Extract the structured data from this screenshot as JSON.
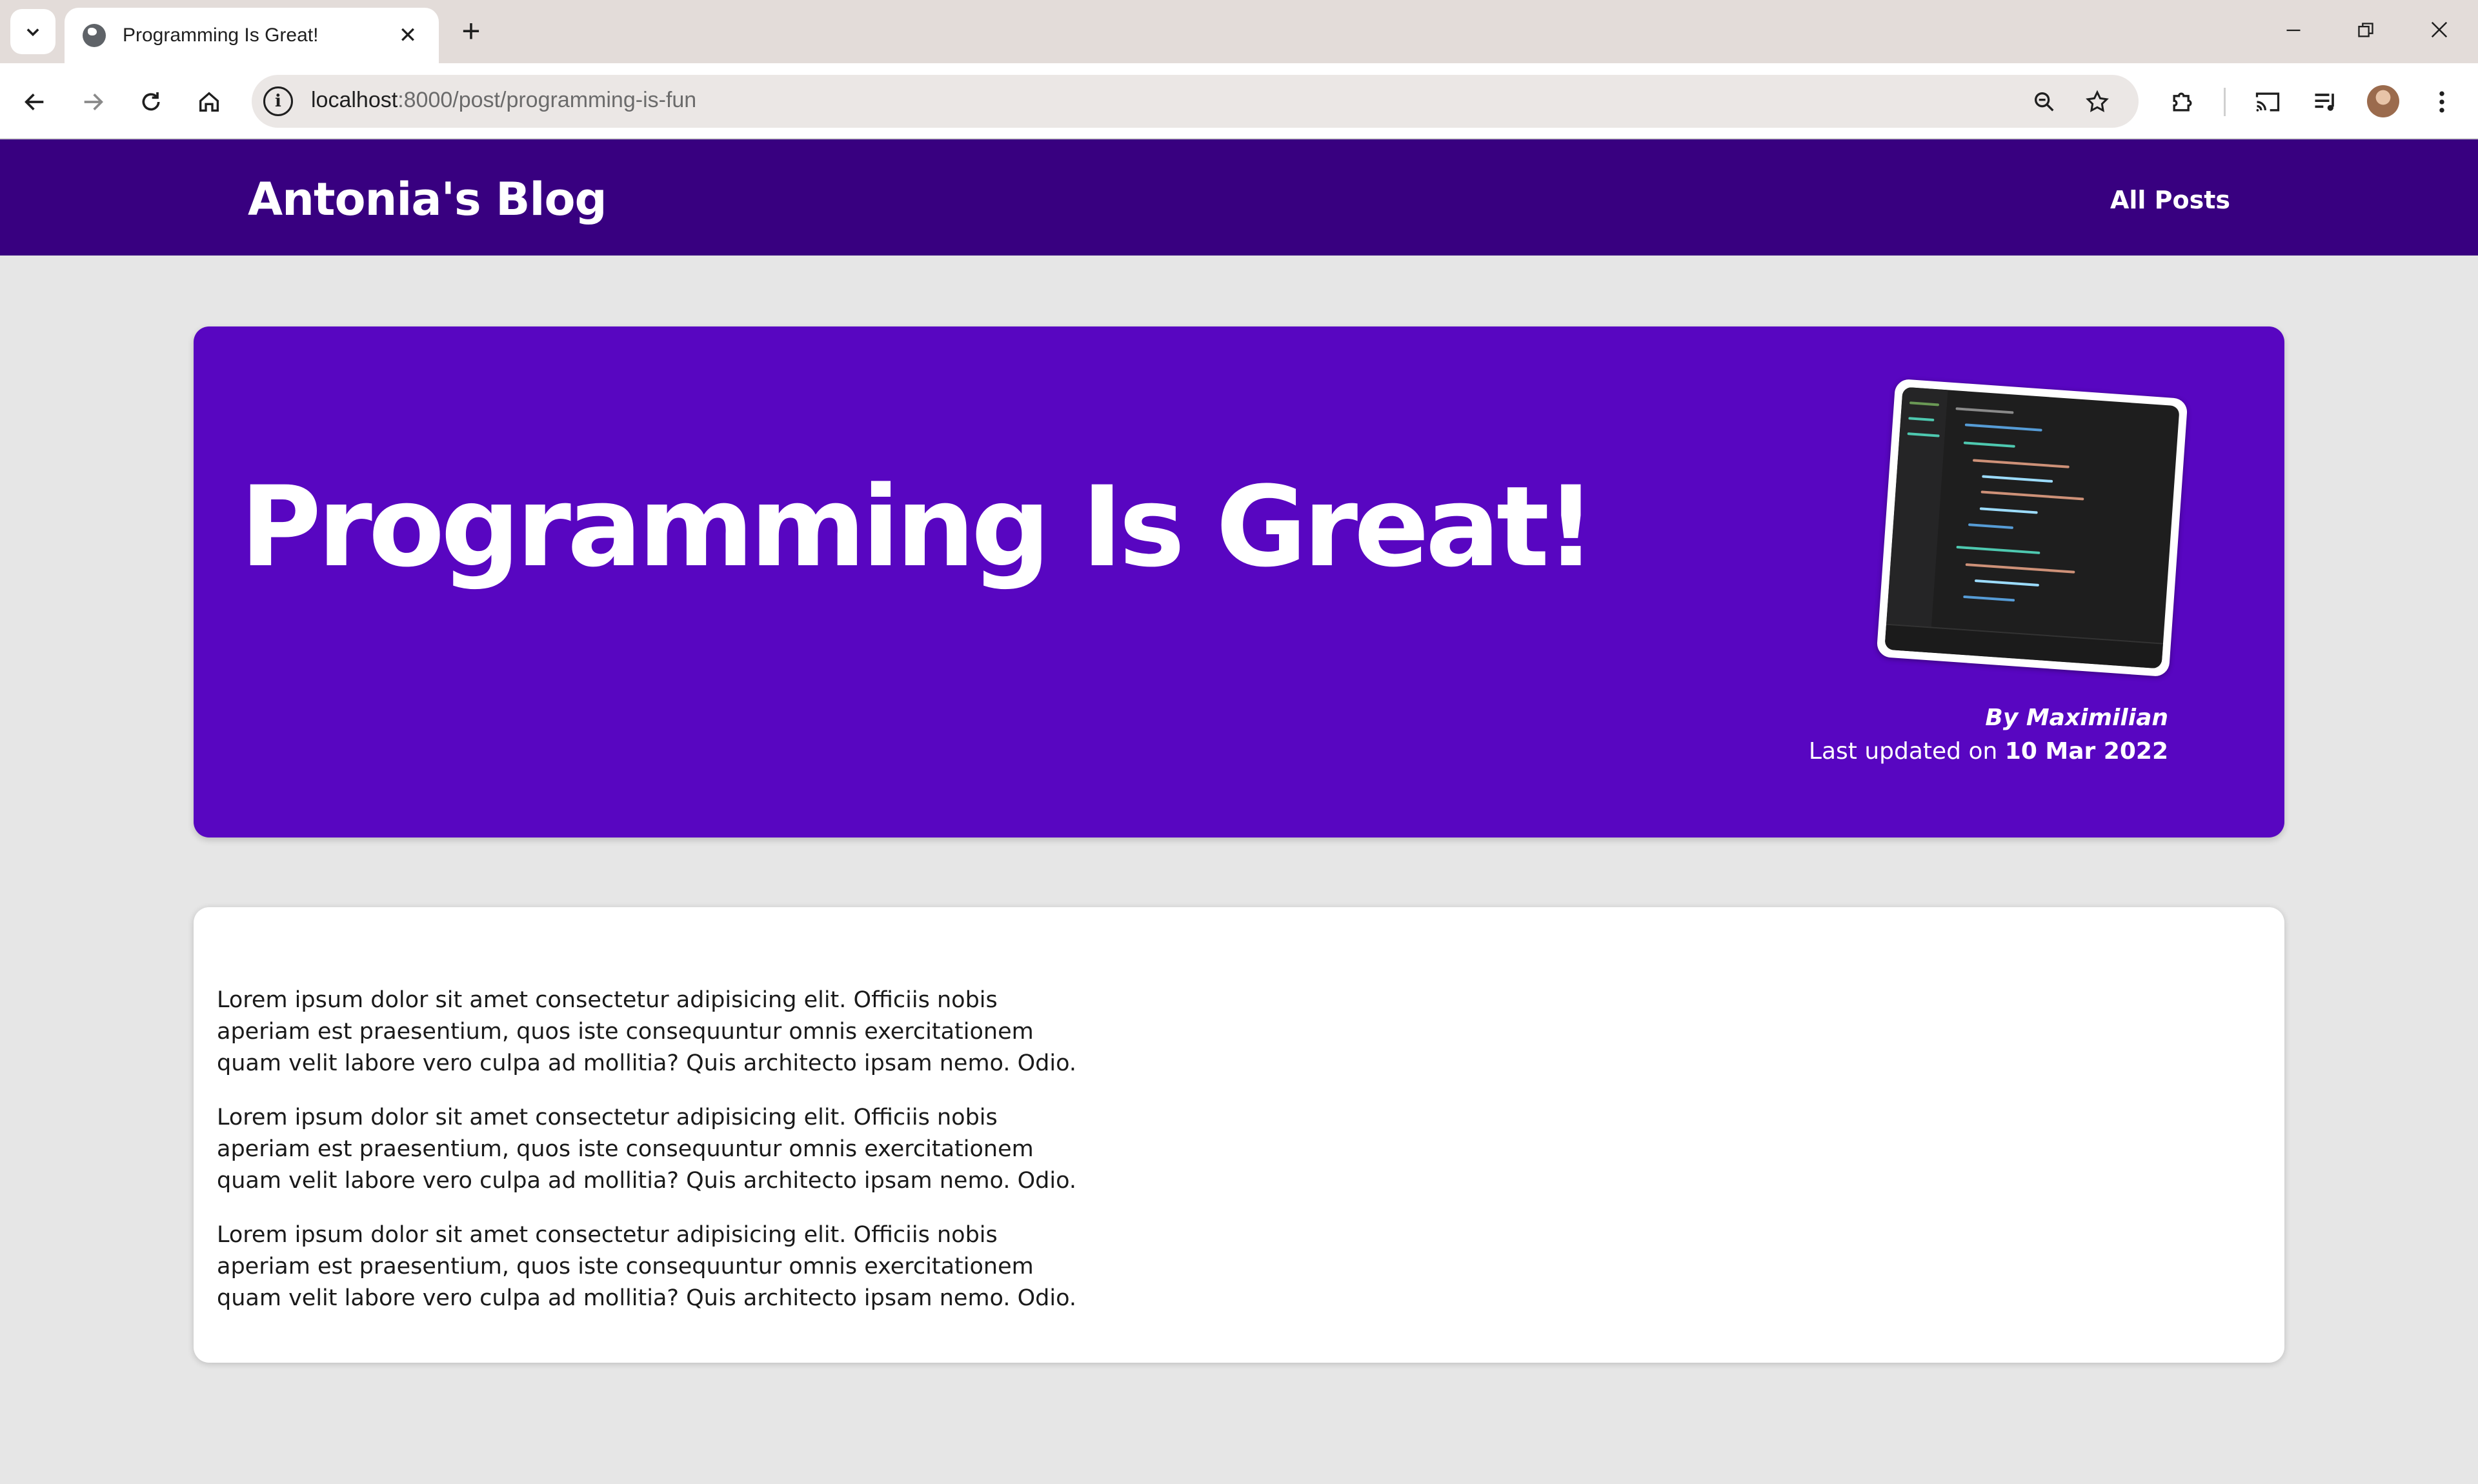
{
  "browser": {
    "tab_title": "Programming Is Great!",
    "url_host": "localhost",
    "url_path": ":8000/post/programming-is-fun",
    "new_tab": "+",
    "tab_close": "✕"
  },
  "site": {
    "title": "Antonia's Blog",
    "nav_all_posts": "All Posts"
  },
  "post": {
    "title": "Programming Is Great!",
    "author_line": "By Maximilian",
    "updated_prefix": "Last updated on ",
    "updated_date": "10 Mar 2022",
    "image_alt": "code editor screenshot",
    "paragraphs": [
      "Lorem ipsum dolor sit amet consectetur adipisicing elit. Officiis nobis aperiam est praesentium, quos iste consequuntur omnis exercitationem quam velit labore vero culpa ad mollitia? Quis architecto ipsam nemo. Odio.",
      "Lorem ipsum dolor sit amet consectetur adipisicing elit. Officiis nobis aperiam est praesentium, quos iste consequuntur omnis exercitationem quam velit labore vero culpa ad mollitia? Quis architecto ipsam nemo. Odio.",
      "Lorem ipsum dolor sit amet consectetur adipisicing elit. Officiis nobis aperiam est praesentium, quos iste consequuntur omnis exercitationem quam velit labore vero culpa ad mollitia? Quis architecto ipsam nemo. Odio."
    ]
  },
  "colors": {
    "header_bg": "#380080",
    "hero_bg": "#5806c1",
    "page_bg": "#e6e6e6",
    "tabstrip_bg": "#e3dcd9"
  },
  "icons": {
    "tab_search": "chevron-down-icon",
    "favicon": "globe-icon",
    "back": "arrow-left-icon",
    "forward": "arrow-right-icon",
    "reload": "reload-icon",
    "home": "home-icon",
    "site_info": "info-icon",
    "zoom": "zoom-out-icon",
    "bookmark": "star-icon",
    "extensions": "puzzle-icon",
    "cast": "cast-icon",
    "media": "media-queue-icon",
    "menu": "kebab-menu-icon"
  }
}
